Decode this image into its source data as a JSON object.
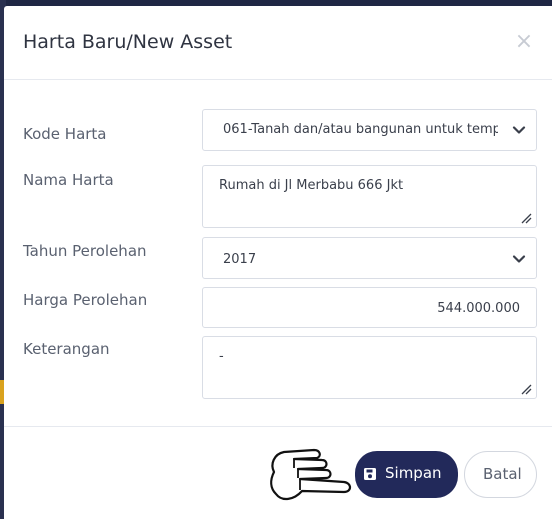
{
  "modal": {
    "title": "Harta Baru/New Asset",
    "close_label": "×"
  },
  "form": {
    "kode_harta": {
      "label": "Kode Harta",
      "value": "061-Tanah dan/atau bangunan untuk temp"
    },
    "nama_harta": {
      "label": "Nama Harta",
      "value": "Rumah di Jl Merbabu 666 Jkt"
    },
    "tahun_perolehan": {
      "label": "Tahun Perolehan",
      "value": "2017"
    },
    "harga_perolehan": {
      "label": "Harga Perolehan",
      "value": "544.000.000"
    },
    "keterangan": {
      "label": "Keterangan",
      "value": "-"
    }
  },
  "footer": {
    "save_label": "Simpan",
    "cancel_label": "Batal"
  },
  "icons": {
    "close": "close-icon",
    "chevron": "chevron-down-icon",
    "save": "floppy-disk-icon",
    "resize": "resize-grip-icon",
    "pointer": "pointing-hand-icon"
  },
  "colors": {
    "primary": "#22295a",
    "backdrop": "#2d3554",
    "accent": "#d9a21e"
  }
}
